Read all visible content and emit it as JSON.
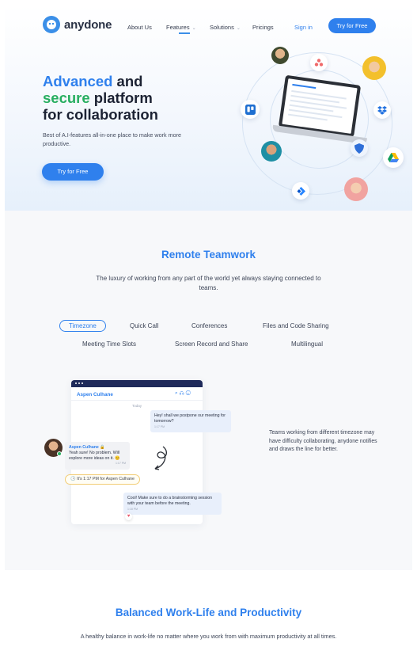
{
  "nav": {
    "brand": "anydone",
    "links": [
      {
        "label": "About Us"
      },
      {
        "label": "Features"
      },
      {
        "label": "Solutions"
      },
      {
        "label": "Pricings"
      }
    ],
    "signin": "Sign in",
    "cta": "Try for Free"
  },
  "hero": {
    "title_part1": "Advanced",
    "title_part2": " and",
    "title_part3": "secure",
    "title_part4": " platform",
    "title_part5": "for collaboration",
    "subtitle": "Best of A.I-features all-in-one place to make work more productive.",
    "cta": "Try for Free",
    "icons": [
      "trello-icon",
      "asana-icon",
      "dropbox-icon",
      "shield-icon",
      "google-drive-icon",
      "jira-icon"
    ],
    "colors": {
      "primary": "#2f80ed",
      "green": "#27ae60"
    }
  },
  "remote": {
    "title": "Remote Teamwork",
    "subtitle": "The luxury of working from any part of the world yet always staying connected to teams.",
    "tabs": [
      "Timezone",
      "Quick Call",
      "Conferences",
      "Files and Code Sharing",
      "Meeting Time Slots",
      "Screen Record and Share",
      "Multilingual"
    ],
    "active_tab": "Timezone",
    "chat": {
      "contact": "Aspen Culhane",
      "date": "Today",
      "msg1": "Hey! shall we postpone our meeting for tomorrow?",
      "msg1_time": "1:17 PM",
      "msg2_name": "Aspen Culhane 🔒",
      "msg2": "Yeah sure! No problem. Will explore more ideas on it. 😊",
      "msg2_time": "1:17 PM",
      "reminder": "It's 1:17 PM for Aspen Culhane",
      "msg3": "Cool! Make sure to do a brainstorming session with your team before the meeting.",
      "msg3_time": "1:18 PM"
    },
    "description": "Teams working from different timezone may have difficulty collaborating, anydone notifies and draws the line for better."
  },
  "balanced": {
    "title": "Balanced Work-Life and Productivity",
    "subtitle": "A healthy balance in work-life no matter where you work from with maximum productivity at all times."
  }
}
